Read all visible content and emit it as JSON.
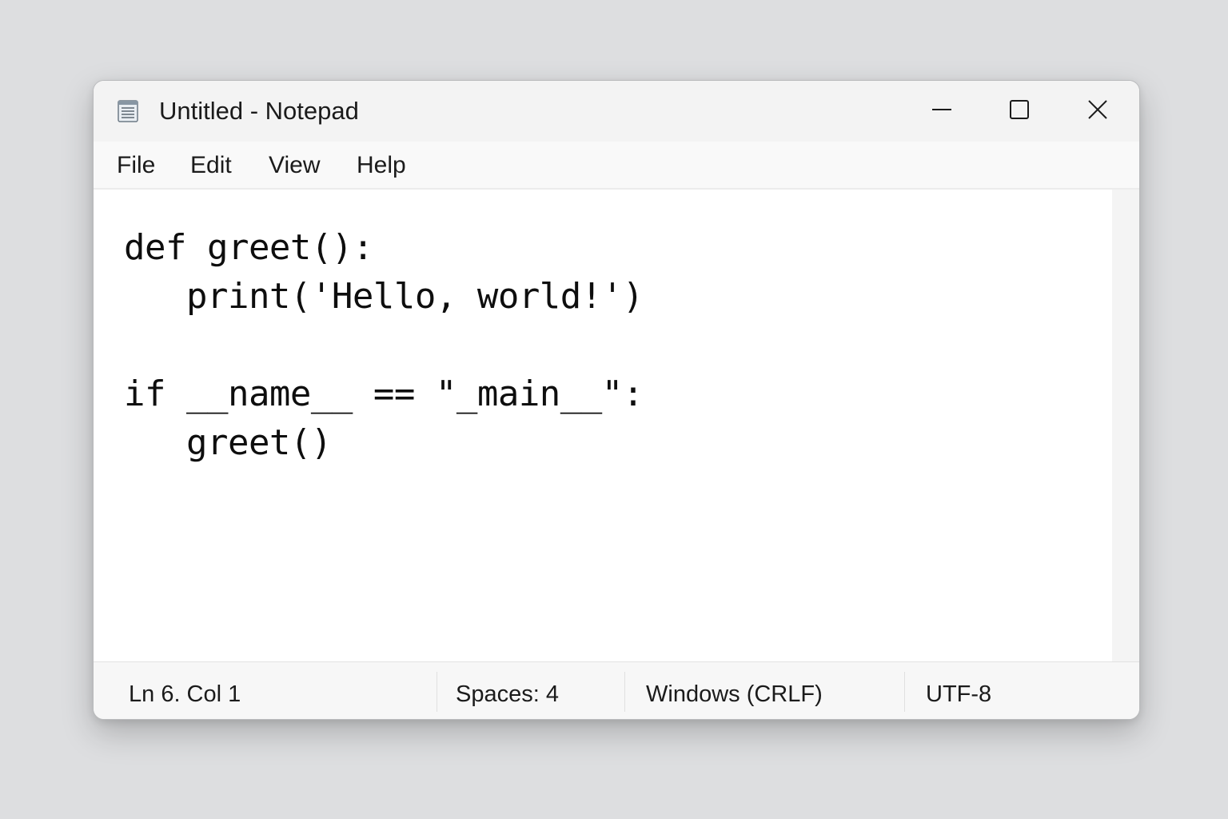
{
  "window": {
    "title": "Untitled - Notepad",
    "icon": "notepad-icon",
    "controls": {
      "minimize_icon": "minimize-icon",
      "maximize_icon": "maximize-icon",
      "close_icon": "close-icon"
    }
  },
  "menu": {
    "items": [
      {
        "label": "File"
      },
      {
        "label": "Edit"
      },
      {
        "label": "View"
      },
      {
        "label": "Help"
      }
    ]
  },
  "editor": {
    "lines": [
      "def greet():",
      "   print('Hello, world!')",
      "",
      "if __name__ == \"_main__\":",
      "   greet()"
    ]
  },
  "status": {
    "position": "Ln 6. Col 1",
    "indentation": "Spaces: 4",
    "line_endings": "Windows (CRLF)",
    "encoding": "UTF-8"
  },
  "colors": {
    "background": "#dddee0",
    "titlebar": "#f3f3f3",
    "editor": "#ffffff",
    "text": "#1b1b1b"
  }
}
